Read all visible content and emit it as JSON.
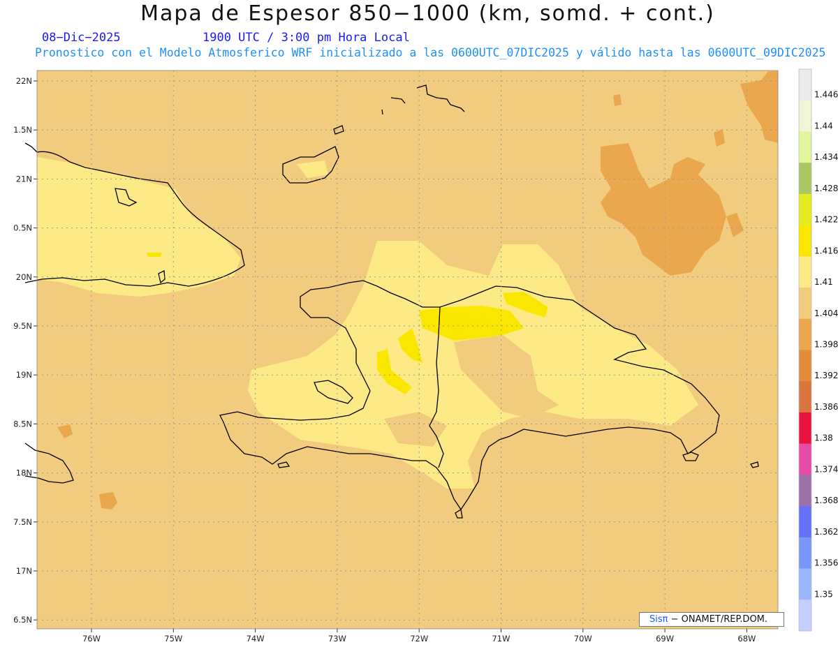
{
  "header": {
    "title": "Mapa de Espesor 850−1000 (km, somd. + cont.)",
    "date": "08−Dic−2025",
    "time": "1900 UTC / 3:00 pm Hora Local",
    "description": "Pronostico con el Modelo Atmosferico WRF inicializado a las 0600UTC_07DIC2025 y válido hasta las  0600UTC_09DIC2025"
  },
  "axes": {
    "lon_labels": [
      "76W",
      "75W",
      "74W",
      "73W",
      "72W",
      "71W",
      "70W",
      "69W",
      "68W"
    ],
    "lat_labels": [
      "22N",
      "1.5N",
      "21N",
      "0.5N",
      "20N",
      "9.5N",
      "19N",
      "8.5N",
      "18N",
      "7.5N",
      "17N",
      "6.5N"
    ]
  },
  "colorbar": {
    "levels": [
      "1.446",
      "1.44",
      "1.434",
      "1.428",
      "1.422",
      "1.416",
      "1.41",
      "1.404",
      "1.398",
      "1.392",
      "1.386",
      "1.38",
      "1.374",
      "1.368",
      "1.362",
      "1.356",
      "1.35"
    ],
    "colors": [
      "#ebebeb",
      "#eff5d6",
      "#e3f59c",
      "#a9c864",
      "#e4ec1e",
      "#f9e700",
      "#fbe986",
      "#f2cc7e",
      "#eba74d",
      "#e38d3c",
      "#db753f",
      "#e8123f",
      "#e64ba6",
      "#9c70a8",
      "#6470f7",
      "#7996fa",
      "#9cb6fd",
      "#c3d0fe"
    ]
  },
  "map_colors": {
    "ocean": "#f2cc7e",
    "warm": "#fbe986",
    "warmer": "#f9e700",
    "cool": "#eba74d",
    "coast": "#000000"
  },
  "credit": {
    "brand": "Sisπ",
    "text": "− ONAMET/REP.DOM."
  }
}
